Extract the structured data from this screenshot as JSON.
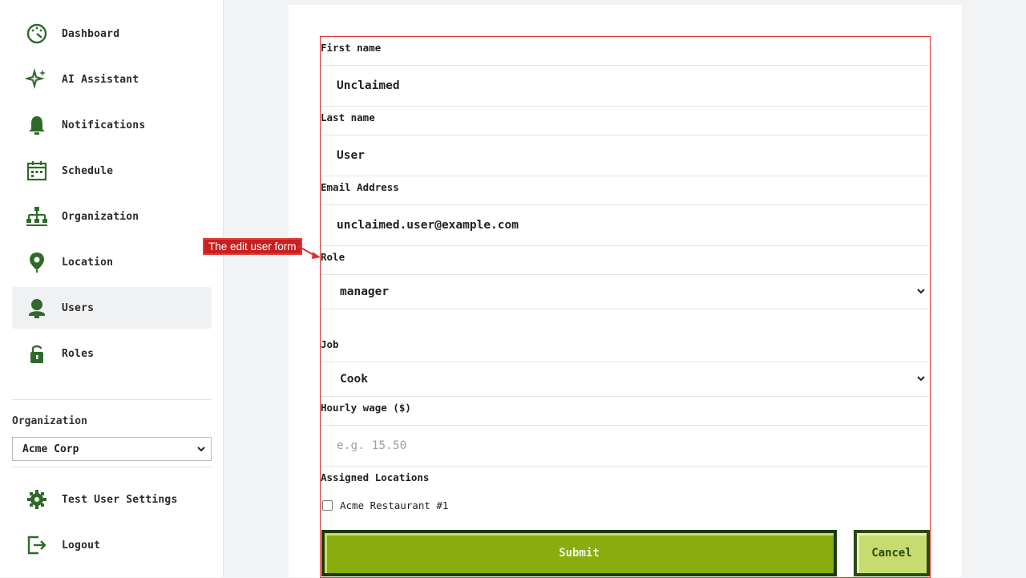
{
  "sidebar": {
    "items": [
      {
        "label": "Dashboard",
        "icon": "dashboard-icon",
        "active": false
      },
      {
        "label": "AI Assistant",
        "icon": "sparkle-icon",
        "active": false
      },
      {
        "label": "Notifications",
        "icon": "bell-icon",
        "active": false
      },
      {
        "label": "Schedule",
        "icon": "calendar-icon",
        "active": false
      },
      {
        "label": "Organization",
        "icon": "org-chart-icon",
        "active": false
      },
      {
        "label": "Location",
        "icon": "location-pin-icon",
        "active": false
      },
      {
        "label": "Users",
        "icon": "user-icon",
        "active": true
      },
      {
        "label": "Roles",
        "icon": "lock-icon",
        "active": false
      }
    ],
    "organization_label": "Organization",
    "organization_value": "Acme Corp",
    "settings_label": "Test User Settings",
    "logout_label": "Logout"
  },
  "form": {
    "first_name_label": "First name",
    "first_name_value": "Unclaimed",
    "last_name_label": "Last name",
    "last_name_value": "User",
    "email_label": "Email Address",
    "email_value": "unclaimed.user@example.com",
    "role_label": "Role",
    "role_value": "manager",
    "job_label": "Job",
    "job_value": "Cook",
    "wage_label": "Hourly wage ($)",
    "wage_placeholder": "e.g. 15.50",
    "locations_label": "Assigned Locations",
    "location_option": "Acme Restaurant #1",
    "location_checked": false,
    "submit_label": "Submit",
    "cancel_label": "Cancel"
  },
  "annotation": {
    "text": "The edit user form"
  },
  "colors": {
    "icon_green": "#2f6a2a",
    "submit_bg": "#8aac0f",
    "cancel_bg": "#c6dc70",
    "highlight_red": "#e03030"
  }
}
